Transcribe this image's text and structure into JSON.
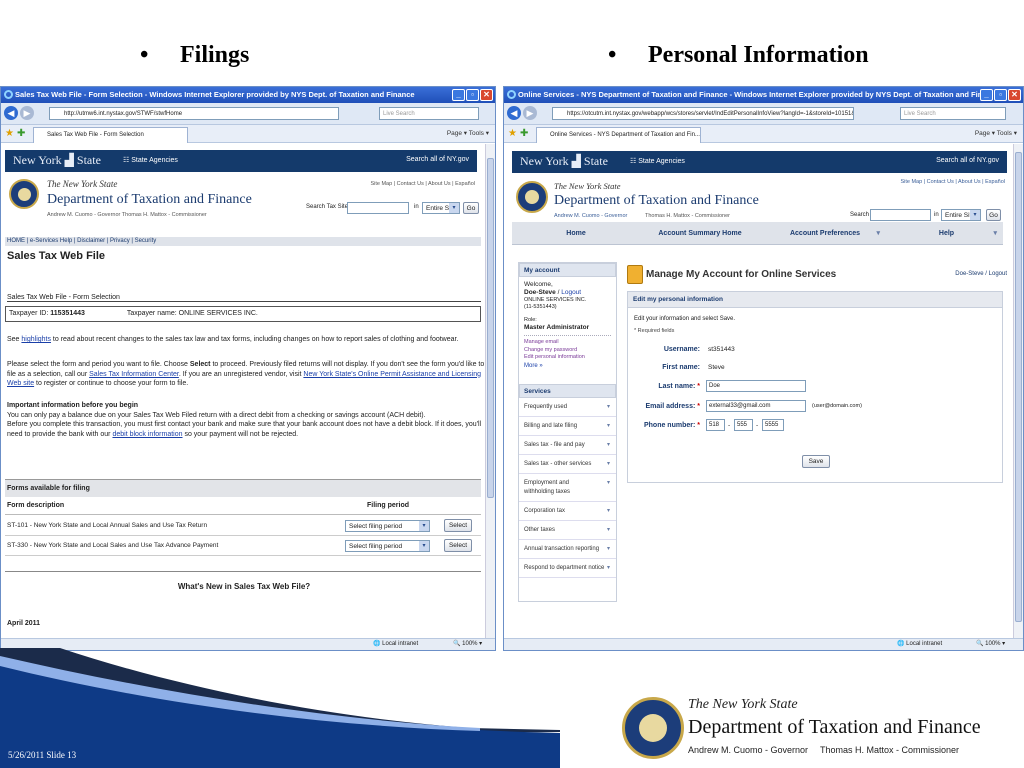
{
  "slide": {
    "title_left": "Filings",
    "title_right": "Personal Information",
    "footer": "5/26/2011 Slide 13",
    "logo_line1": "The New York State",
    "logo_line2": "Department of Taxation and Finance",
    "logo_line3": "Andrew M. Cuomo - Governor",
    "logo_line4": "Thomas H. Mattox - Commissioner"
  },
  "w1": {
    "title": "Sales Tax Web File - Form Selection - Windows Internet Explorer provided by NYS Dept. of Taxation and Finance",
    "url": "http://utmw6.int.nystax.gov/STWF/stwfHome",
    "live_search": "Live Search",
    "tab": "Sales Tax Web File - Form Selection",
    "tools": "Page ▾  Tools ▾",
    "ny_logo": "New York ▟ State",
    "agencies": "☷ State Agencies",
    "search_ny": "Search all of NY.gov",
    "nys": "The New York State",
    "dept": "Department of Taxation and Finance",
    "officials": "Andrew M. Cuomo - Governor    Thomas H. Mattox - Commissioner",
    "toplinks": "Site Map | Contact Us | About Us | Español",
    "search_label": "Search Tax Site",
    "in_label": "in",
    "search_scope": "Entire Site",
    "go": "Go",
    "crumbs": "HOME | e-Services Help | Disclaimer | Privacy | Security",
    "page_title": "Sales Tax Web File",
    "subtitle": "Sales Tax Web File - Form Selection",
    "tp_label": "Taxpayer ID:",
    "tp_id": "115351443",
    "tn_label": "Taxpayer name:",
    "tn": "ONLINE SERVICES INC.",
    "p1a": "See ",
    "p1link": "highlights",
    "p1b": " to read about recent changes to the sales tax law and tax forms, including changes on how to report sales of clothing and footwear.",
    "p2a": "Please select the form and period you want to file. Choose ",
    "p2b": "Select",
    "p2c": " to proceed. Previously filed returns will not display. If you don't see the form you'd like to file as a selection, call our ",
    "p2link1": "Sales Tax Information Center",
    "p2d": ". If you are an unregistered vendor, visit ",
    "p2link2": "New York State's Online Permit Assistance and Licensing Web site",
    "p2e": " to register or continue to choose your form to file.",
    "imp_head": "Important information before you begin",
    "imp1": "You can only pay a balance due on your Sales Tax Web Filed return with a direct debit from a checking or savings account (ACH debit).",
    "imp2": "Before you complete this transaction, you must first contact your bank and make sure that your bank account does not have a debit block. If it does, you'll need to provide the bank with our ",
    "imp_link": "debit block information",
    "imp3": " so your payment will not be rejected.",
    "forms_head": "Forms available for filing",
    "col_desc": "Form description",
    "col_period": "Filing period",
    "forms": [
      {
        "desc": "ST-101 - New York State and Local Annual Sales and Use Tax Return",
        "period": "Select filing period",
        "btn": "Select"
      },
      {
        "desc": "ST-330 - New York State and Local Sales and Use Tax Advance Payment",
        "period": "Select filing period",
        "btn": "Select"
      }
    ],
    "whats_new": "What's New in Sales Tax Web File?",
    "april": "April 2011",
    "zone": "Local intranet",
    "zoom": "100%"
  },
  "w2": {
    "title": "Online Services - NYS Department of Taxation and Finance - Windows Internet Explorer provided by NYS Dept. of Taxation and Fina",
    "url": "https://otcutm.int.nystax.gov/webapp/wcs/stores/servlet/IndEditPersonalInfoView?langId=-1&storeId=10151&catalo",
    "live_search": "Live Search",
    "tab": "Online Services - NYS Department of Taxation and Fin...",
    "tools": "Page ▾  Tools ▾",
    "ny_logo": "New York ▟ State",
    "agencies": "☷ State Agencies",
    "search_ny": "Search all of NY.gov",
    "nys": "The New York State",
    "dept": "Department of Taxation and Finance",
    "gov": "Andrew M. Cuomo - Governor",
    "comm": "Thomas H. Mattox - Commissioner",
    "toplinks": "Site Map | Contact Us | About Us | Español",
    "search_label": "Search",
    "in_label": "in",
    "search_scope": "Entire Site",
    "go": "Go",
    "nav": [
      "Home",
      "Account Summary Home",
      "Account Preferences",
      "Help"
    ],
    "my_account": "My account",
    "welcome": "Welcome,",
    "user": "Doe-Steve",
    "logout": "Logout",
    "company": "ONLINE SERVICES INC.",
    "company_id": "(11-5351443)",
    "role_label": "Role:",
    "role": "Master Administrator",
    "links": [
      "Manage email",
      "Change my password",
      "Edit personal information",
      "More »"
    ],
    "services_head": "Services",
    "services": [
      "Frequently used",
      "Billing and late filing",
      "Sales tax - file and pay",
      "Sales tax - other services",
      "Employment and withholding taxes",
      "Corporation tax",
      "Other taxes",
      "Annual transaction reporting",
      "Respond to department notice"
    ],
    "heading": "Manage My Account for Online Services",
    "user_right": "Doe-Steve / Logout",
    "section": "Edit my personal information",
    "instr": "Edit your information and select Save.",
    "required": "* Required fields",
    "fields": {
      "username_label": "Username:",
      "username": "st351443",
      "first_label": "First name:",
      "first": "Steve",
      "last_label": "Last name:",
      "last": "Doe",
      "email_label": "Email address:",
      "email": "external33@gmail.com",
      "email_hint": "(user@domain.com)",
      "phone_label": "Phone number:",
      "phone1": "518",
      "phone2": "555",
      "phone3": "5555"
    },
    "save": "Save",
    "zone": "Local intranet",
    "zoom": "100%"
  }
}
